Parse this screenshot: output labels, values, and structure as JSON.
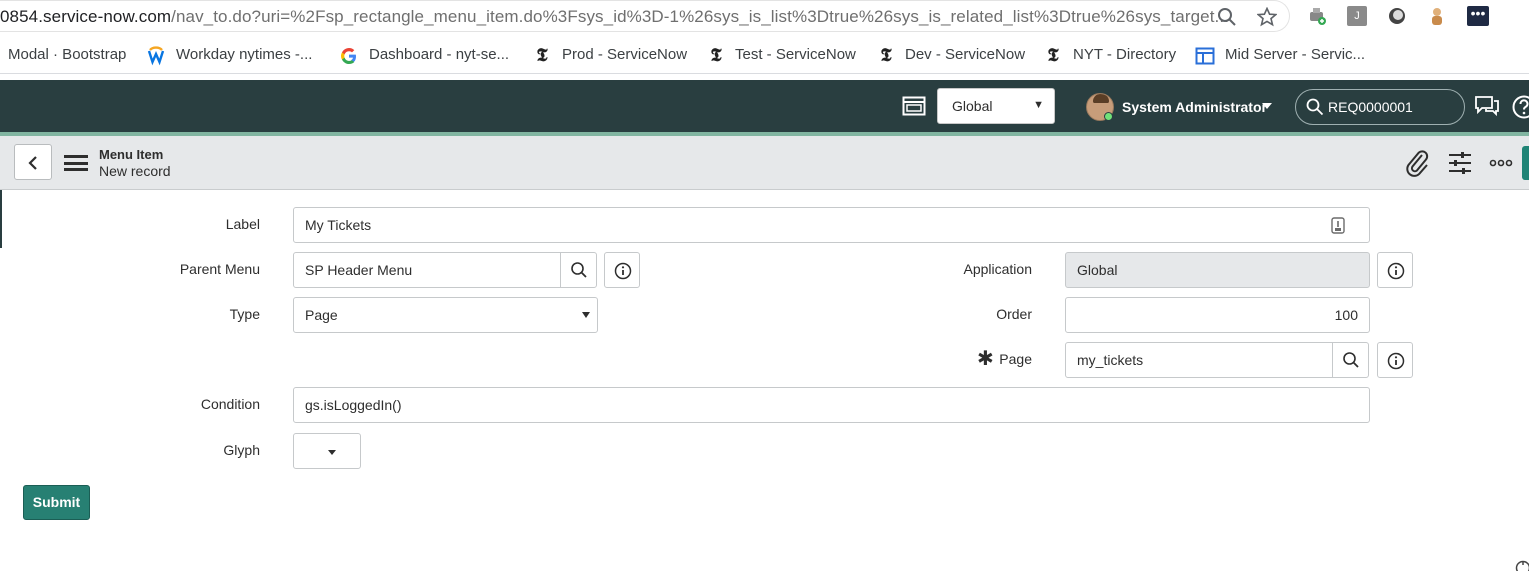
{
  "browser": {
    "url_host": "0854.service-now.com",
    "url_path": "/nav_to.do?uri=%2Fsp_rectangle_menu_item.do%3Fsys_id%3D-1%26sys_is_list%3Dtrue%26sys_is_related_list%3Dtrue%26sys_target...",
    "bookmarks": [
      {
        "label": "Modal · Bootstrap",
        "icon": ""
      },
      {
        "label": "Workday nytimes -...",
        "icon": "workday-icon"
      },
      {
        "label": "Dashboard - nyt-se...",
        "icon": "google-icon"
      },
      {
        "label": "Prod - ServiceNow",
        "icon": "nyt-icon"
      },
      {
        "label": "Test - ServiceNow",
        "icon": "nyt-icon"
      },
      {
        "label": "Dev - ServiceNow",
        "icon": "nyt-icon"
      },
      {
        "label": "NYT - Directory",
        "icon": "nyt-icon"
      },
      {
        "label": "Mid Server - Servic...",
        "icon": "window-icon"
      }
    ],
    "extension_j_label": "J"
  },
  "header": {
    "scope": "Global",
    "user_name": "System Administrator",
    "search_value": "REQ0000001",
    "bg_color": "#293e40",
    "accent_color": "#81b5a1"
  },
  "form_header": {
    "title": "Menu Item",
    "subtitle": "New record"
  },
  "form": {
    "label": {
      "label": "Label",
      "value": "My Tickets"
    },
    "parent_menu": {
      "label": "Parent Menu",
      "value": "SP Header Menu"
    },
    "type": {
      "label": "Type",
      "value": "Page"
    },
    "condition": {
      "label": "Condition",
      "value": "gs.isLoggedIn()"
    },
    "glyph": {
      "label": "Glyph"
    },
    "application": {
      "label": "Application",
      "value": "Global"
    },
    "order": {
      "label": "Order",
      "value": "100"
    },
    "page": {
      "label": "Page",
      "value": "my_tickets",
      "required_mark": "✱"
    }
  },
  "actions": {
    "submit_label": "Submit",
    "submit_color": "#278073"
  }
}
